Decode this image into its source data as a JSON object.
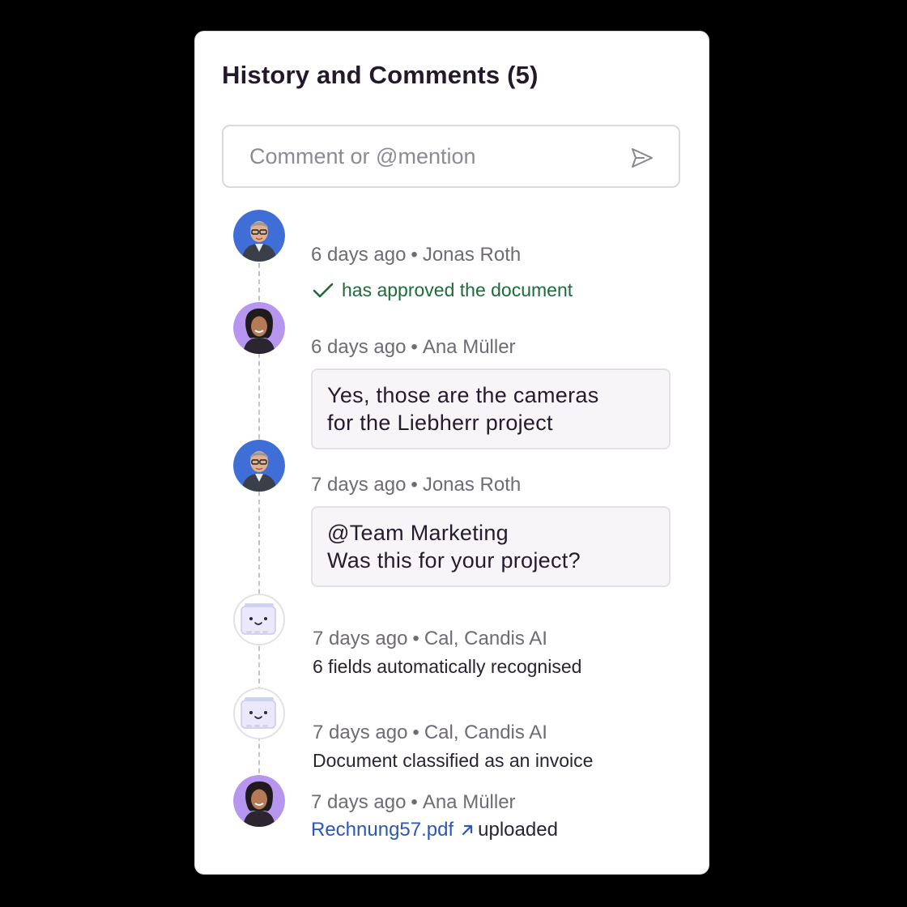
{
  "panel": {
    "title": "History and Comments (5)"
  },
  "comment_input": {
    "placeholder": "Comment or @mention",
    "value": ""
  },
  "entries": [
    {
      "time": "6 days ago",
      "author": "Jonas Roth",
      "avatar": "person-icon",
      "action": "has approved the document"
    },
    {
      "time": "6 days ago",
      "author": "Ana Müller",
      "avatar": "person-icon",
      "comment_lines": [
        "Yes, those are the cameras",
        "for the Liebherr project"
      ]
    },
    {
      "time": "7 days ago",
      "author": "Jonas Roth",
      "avatar": "person-icon",
      "comment_lines": [
        "@Team Marketing",
        "Was this for your project?"
      ]
    },
    {
      "time": "7 days ago",
      "author": "Cal, Candis AI",
      "avatar": "bot-icon",
      "detail": "6 fields automatically recognised"
    },
    {
      "time": "7 days ago",
      "author": "Cal, Candis AI",
      "avatar": "bot-icon",
      "detail": "Document classified as an invoice"
    },
    {
      "time": "7 days ago",
      "author": "Ana Müller",
      "avatar": "person-icon",
      "file_name": "Rechnung57.pdf",
      "file_action": "uploaded"
    }
  ],
  "separator": "•",
  "colors": {
    "approved": "#1d6b3a",
    "link": "#2c57b8",
    "jonas_avatar_bg": "#3f6fd6",
    "ana_avatar_bg": "#b796ef"
  }
}
